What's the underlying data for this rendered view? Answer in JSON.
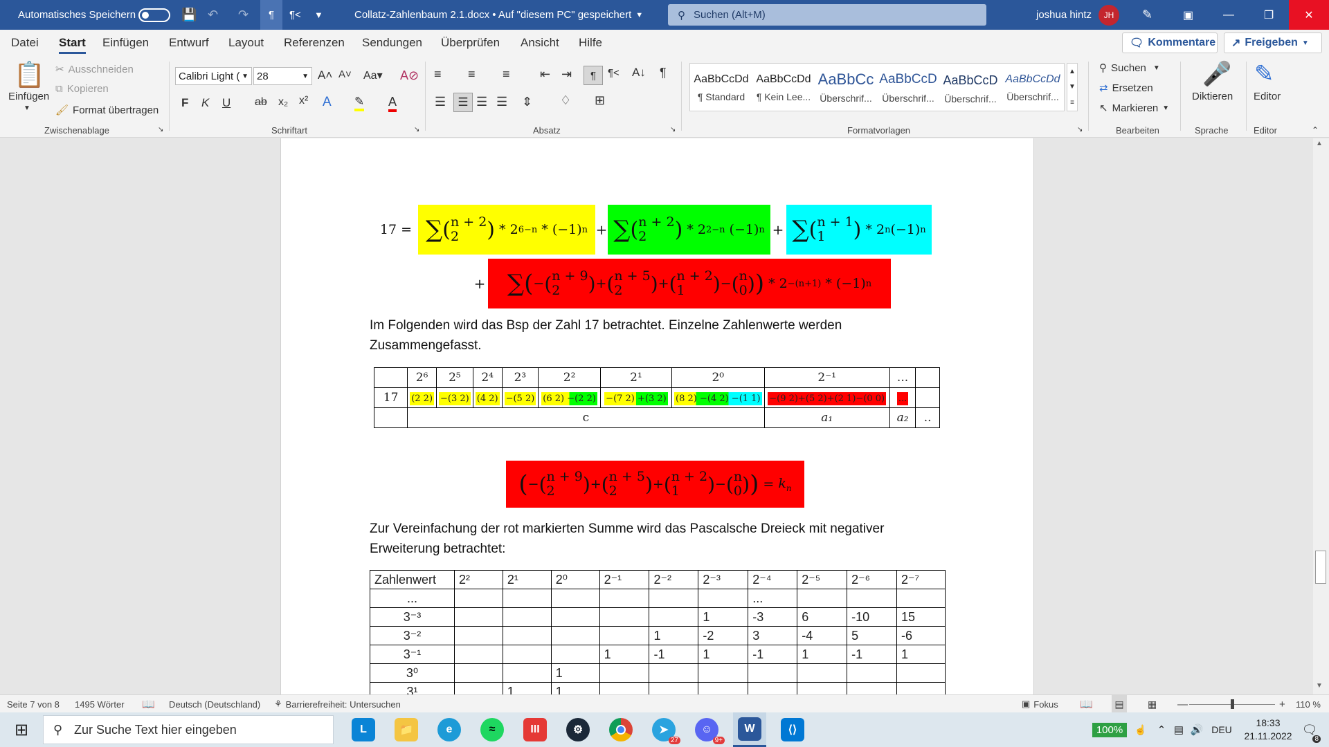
{
  "titlebar": {
    "autosave_label": "Automatisches Speichern",
    "doc_title": "Collatz-Zahlenbaum 2.1.docx • Auf \"diesem PC\" gespeichert",
    "search_placeholder": "Suchen (Alt+M)",
    "user_name": "joshua hintz",
    "user_initials": "JH"
  },
  "menu": {
    "tabs": [
      "Datei",
      "Start",
      "Einfügen",
      "Entwurf",
      "Layout",
      "Referenzen",
      "Sendungen",
      "Überprüfen",
      "Ansicht",
      "Hilfe"
    ],
    "active_tab": "Start",
    "comments_label": "Kommentare",
    "share_label": "Freigeben"
  },
  "ribbon": {
    "clipboard": {
      "paste": "Einfügen",
      "cut": "Ausschneiden",
      "copy": "Kopieren",
      "format_painter": "Format übertragen",
      "group": "Zwischenablage"
    },
    "font": {
      "name": "Calibri Light (",
      "size": "28",
      "group": "Schriftart"
    },
    "paragraph": {
      "group": "Absatz"
    },
    "styles": {
      "group": "Formatvorlagen",
      "items": [
        {
          "preview": "AaBbCcDd",
          "name": "¶ Standard"
        },
        {
          "preview": "AaBbCcDd",
          "name": "¶ Kein Lee..."
        },
        {
          "preview": "AaBbCc",
          "name": "Überschrif..."
        },
        {
          "preview": "AaBbCcD",
          "name": "Überschrif..."
        },
        {
          "preview": "AaBbCcD",
          "name": "Überschrif..."
        },
        {
          "preview": "AaBbCcDd",
          "name": "Überschrif..."
        }
      ]
    },
    "editing": {
      "find": "Suchen",
      "replace": "Ersetzen",
      "select": "Markieren",
      "group": "Bearbeiten"
    },
    "voice": {
      "dictate": "Diktieren",
      "group": "Sprache"
    },
    "editor": {
      "label": "Editor",
      "group": "Editor"
    }
  },
  "document": {
    "eq1_lhs": "17 =",
    "eq1_term1": "Σ₀⁶ (n+2 über 2) * 2^(6−n) * (−1)^n",
    "eq1_term2": "Σ₀² (n+2 über 2) * 2^(2−n) (−1)^n",
    "eq1_term3": "Σ₀⁰ (n+1 über 1) * 2^n (−1)^n",
    "eq2": "Σₙ₌₀^∞ ( −(n+9 über 2) + (n+5 über 2) + (n+2 über 1) − (n über 0) ) * 2^−(n+1) * (−1)^n",
    "para1_line1": "Im Folgenden wird das Bsp der Zahl 17 betrachtet. Einzelne Zahlenwerte werden",
    "para1_line2": "Zusammengefasst.",
    "table1": {
      "headers": [
        "",
        "2⁶",
        "2⁵",
        "2⁴",
        "2³",
        "2²",
        "2¹",
        "2⁰",
        "2⁻¹",
        "...",
        ""
      ],
      "row_label": "17",
      "cells": [
        "(2 2)",
        "−(3 2)",
        "(4 2)",
        "−(5 2)",
        "(6 2) −(2 2)",
        "−(7 2) +(3 2)",
        "(8 2) −(4 2) −(1 1)",
        "−(9 2)+(5 2)+(2 1)−(0 0)",
        "..."
      ],
      "footer": [
        "",
        "c",
        "a₁",
        "a₂",
        ".."
      ]
    },
    "eq3": "( −(n+9 über 2) + (n+5 über 2) + (n+2 über 1) − (n über 0) ) = kₙ",
    "para2_line1": "Zur Vereinfachung der rot markierten Summe wird das Pascalsche Dreieck mit negativer",
    "para2_line2": "Erweiterung betrachtet:",
    "table2": {
      "headers": [
        "Zahlenwert",
        "2²",
        "2¹",
        "2⁰",
        "2⁻¹",
        "2⁻²",
        "2⁻³",
        "2⁻⁴",
        "2⁻⁵",
        "2⁻⁶",
        "2⁻⁷"
      ],
      "rows": [
        [
          "...",
          "",
          "",
          "",
          "",
          "",
          "",
          "...",
          "",
          "",
          ""
        ],
        [
          "3⁻³",
          "",
          "",
          "",
          "",
          "",
          "1",
          "-3",
          "6",
          "-10",
          "15"
        ],
        [
          "3⁻²",
          "",
          "",
          "",
          "",
          "1",
          "-2",
          "3",
          "-4",
          "5",
          "-6"
        ],
        [
          "3⁻¹",
          "",
          "",
          "",
          "1",
          "-1",
          "1",
          "-1",
          "1",
          "-1",
          "1"
        ],
        [
          "3⁰",
          "",
          "",
          "1",
          "",
          "",
          "",
          "",
          "",
          "",
          ""
        ],
        [
          "3¹",
          "",
          "1",
          "1",
          "",
          "",
          "",
          "",
          "",
          "",
          ""
        ]
      ]
    }
  },
  "statusbar": {
    "page": "Seite 7 von 8",
    "words": "1495 Wörter",
    "language": "Deutsch (Deutschland)",
    "accessibility": "Barrierefreiheit: Untersuchen",
    "focus": "Fokus",
    "zoom": "110 %"
  },
  "taskbar": {
    "search_placeholder": "Zur Suche Text hier eingeben",
    "battery": "100%",
    "lang": "DEU",
    "time": "18:33",
    "date": "21.11.2022",
    "notif_count": "8",
    "telegram_badge": "27",
    "discord_badge": "9+"
  },
  "colors": {
    "word_blue": "#2b579a",
    "highlight_yellow": "#ffff00",
    "highlight_green": "#00ff00",
    "highlight_cyan": "#00ffff",
    "highlight_red": "#ff0000"
  }
}
